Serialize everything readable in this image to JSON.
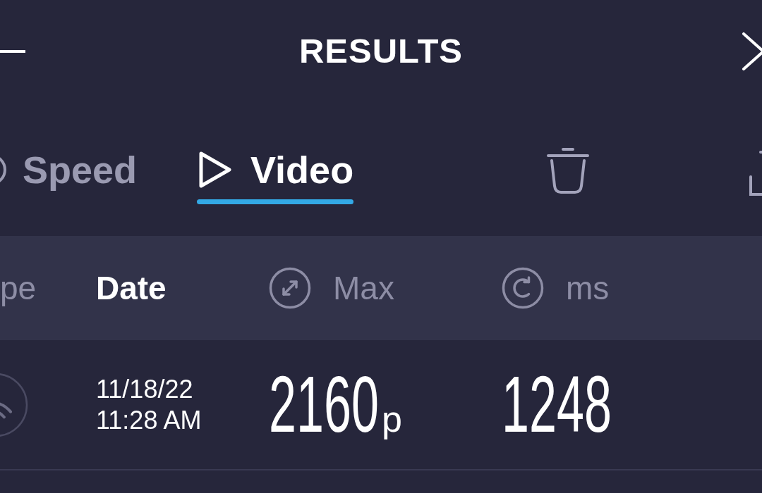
{
  "header": {
    "title": "RESULTS"
  },
  "tabs": [
    {
      "kind": "speed",
      "label": "Speed",
      "selected": false
    },
    {
      "kind": "video",
      "label": "Video",
      "selected": true
    }
  ],
  "columns": [
    {
      "kind": "type",
      "label": "pe",
      "selected": false
    },
    {
      "kind": "date",
      "label": "Date",
      "selected": true
    },
    {
      "kind": "max",
      "label": "Max",
      "selected": false
    },
    {
      "kind": "ms",
      "label": "ms",
      "selected": false
    }
  ],
  "rows": [
    {
      "kind": "wifi",
      "date": "11/18/22",
      "time": "11:28 AM",
      "max": "2160",
      "max_unit": "p",
      "ms": "1248"
    }
  ]
}
